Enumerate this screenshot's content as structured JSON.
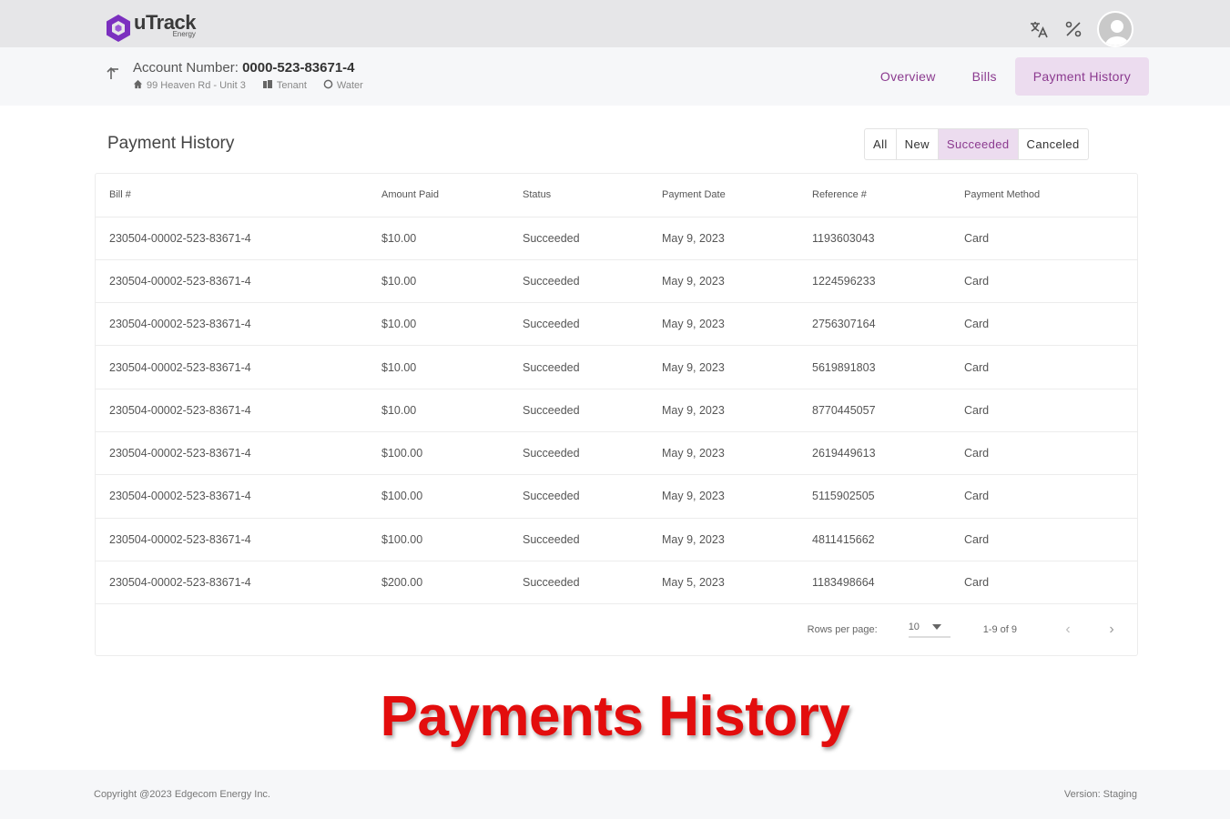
{
  "brand": {
    "name": "uTrack",
    "sub": "Energy",
    "color": "#7b2fbf"
  },
  "topbar": {
    "icons": [
      "translate-icon",
      "percent-icon",
      "avatar"
    ]
  },
  "account": {
    "label": "Account Number:",
    "number": "0000-523-83671-4",
    "address": "99 Heaven Rd - Unit 3",
    "role": "Tenant",
    "utility": "Water"
  },
  "nav": {
    "overview": "Overview",
    "bills": "Bills",
    "payment_history": "Payment History"
  },
  "page": {
    "title": "Payment History"
  },
  "filters": {
    "all": "All",
    "new": "New",
    "succeeded": "Succeeded",
    "canceled": "Canceled"
  },
  "table": {
    "headers": [
      "Bill #",
      "Amount Paid",
      "Status",
      "Payment Date",
      "Reference #",
      "Payment Method"
    ],
    "rows": [
      [
        "230504-00002-523-83671-4",
        "$10.00",
        "Succeeded",
        "May 9, 2023",
        "1193603043",
        "Card"
      ],
      [
        "230504-00002-523-83671-4",
        "$10.00",
        "Succeeded",
        "May 9, 2023",
        "1224596233",
        "Card"
      ],
      [
        "230504-00002-523-83671-4",
        "$10.00",
        "Succeeded",
        "May 9, 2023",
        "2756307164",
        "Card"
      ],
      [
        "230504-00002-523-83671-4",
        "$10.00",
        "Succeeded",
        "May 9, 2023",
        "5619891803",
        "Card"
      ],
      [
        "230504-00002-523-83671-4",
        "$10.00",
        "Succeeded",
        "May 9, 2023",
        "8770445057",
        "Card"
      ],
      [
        "230504-00002-523-83671-4",
        "$100.00",
        "Succeeded",
        "May 9, 2023",
        "2619449613",
        "Card"
      ],
      [
        "230504-00002-523-83671-4",
        "$100.00",
        "Succeeded",
        "May 9, 2023",
        "5115902505",
        "Card"
      ],
      [
        "230504-00002-523-83671-4",
        "$100.00",
        "Succeeded",
        "May 9, 2023",
        "4811415662",
        "Card"
      ],
      [
        "230504-00002-523-83671-4",
        "$200.00",
        "Succeeded",
        "May 5, 2023",
        "1183498664",
        "Card"
      ]
    ]
  },
  "pagination": {
    "rows_label": "Rows per page:",
    "rows_value": "10",
    "range": "1-9 of 9"
  },
  "caption": "Payments History",
  "footer": {
    "copyright": "Copyright @2023 Edgecom Energy Inc.",
    "version": "Version: Staging"
  },
  "colors": {
    "accent": "#8b3a8f",
    "accent_bg": "#ecdcef",
    "caption": "#e30d0d"
  }
}
